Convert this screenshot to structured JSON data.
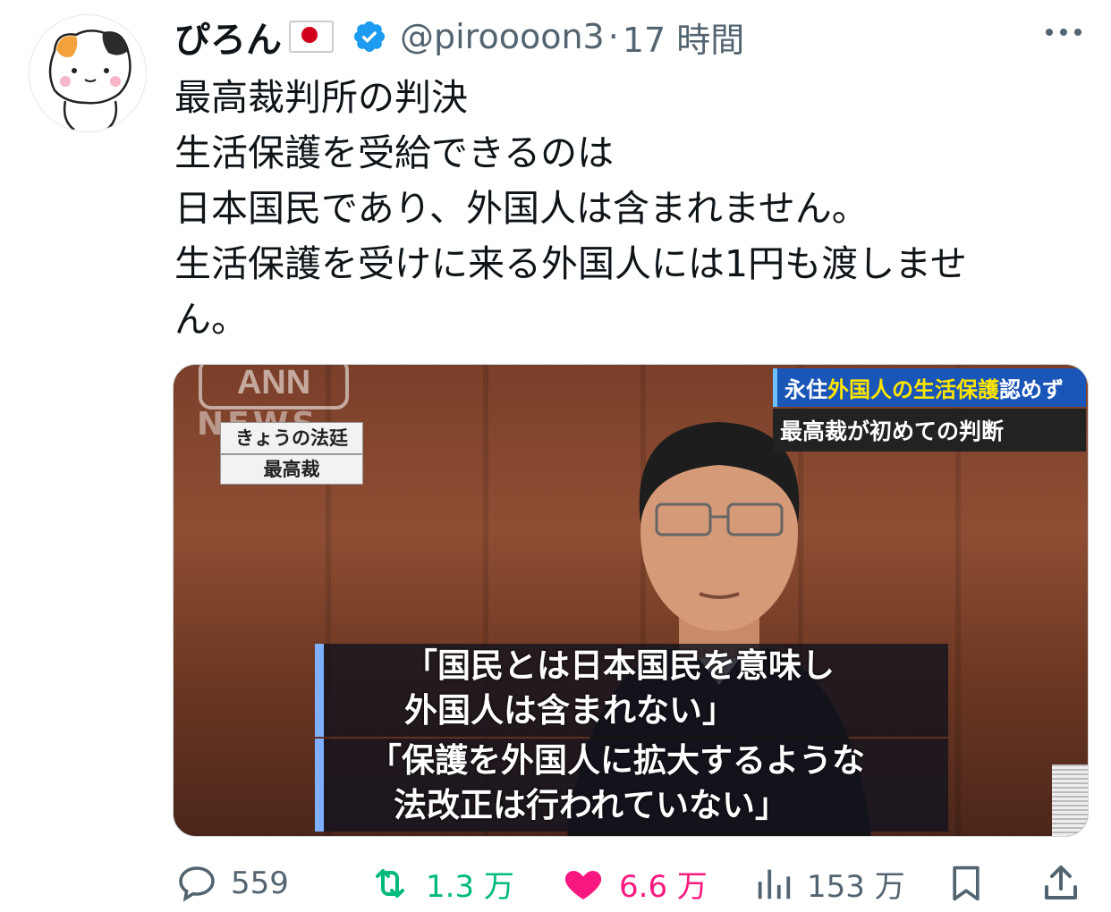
{
  "author": {
    "display_name": "ぴろん",
    "flag_icon": "japan-flag-icon",
    "verified_icon": "verified-badge-icon",
    "handle": "@piroooon3",
    "separator": "·",
    "timestamp": "17 時間"
  },
  "tweet": {
    "lines": [
      "最高裁判所の判決",
      "生活保護を受給できるのは",
      "日本国民であり、外国人は含まれません。",
      "生活保護を受けに来る外国人には1円も渡しませ",
      "ん。"
    ]
  },
  "media": {
    "logo": "ANN",
    "logo_sub": "NEWS",
    "program_label": "きょうの法廷",
    "location_label": "最高裁",
    "headline_prefix": "永住",
    "headline_highlight": "外国人の生活保護",
    "headline_suffix": "認めず",
    "headline_line2": "最高裁が初めての判断",
    "subtitle1_line1": "「国民とは日本国民を意味し",
    "subtitle1_line2": "外国人は含まれない」",
    "subtitle2_line1": "「保護を外国人に拡大するような",
    "subtitle2_line2": "法改正は行われていない」"
  },
  "actions": {
    "reply_count": "559",
    "retweet_count": "1.3 万",
    "like_count": "6.6 万",
    "view_count": "153 万",
    "colors": {
      "retweet": "#00ba7c",
      "like": "#f91880",
      "muted": "#536471",
      "verified": "#1d9bf0"
    }
  }
}
